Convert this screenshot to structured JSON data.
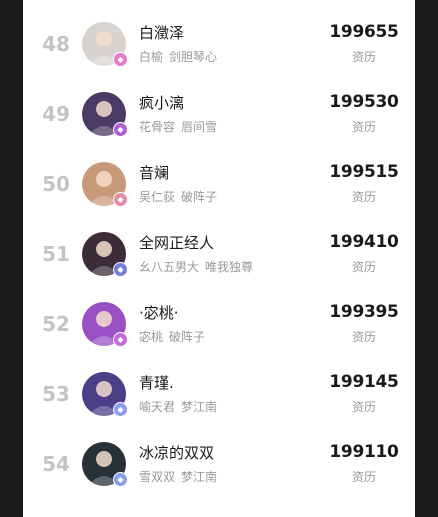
{
  "leaderboard": {
    "rows": [
      {
        "rank": "48",
        "name": "白瀓泽",
        "tags": [
          "白榆",
          "剑胆琴心"
        ],
        "score": "199655",
        "unit": "资历",
        "avatar_icon": "dark-hair-character-avatar-icon",
        "avatar_color": "#d9d3cf",
        "badge_color": "#e879c8"
      },
      {
        "rank": "49",
        "name": "疯小漓",
        "tags": [
          "花骨容",
          "眉间雪"
        ],
        "score": "199530",
        "unit": "资历",
        "avatar_icon": "purple-portrait-avatar-icon",
        "avatar_color": "#4a3a64",
        "badge_color": "#b15cd8"
      },
      {
        "rank": "50",
        "name": "音斓",
        "tags": [
          "吴仁荻",
          "破阵子"
        ],
        "score": "199515",
        "unit": "资历",
        "avatar_icon": "brown-hair-girl-avatar-icon",
        "avatar_color": "#c89a78",
        "badge_color": "#e48ca8"
      },
      {
        "rank": "51",
        "name": "全网正经人",
        "tags": [
          "幺八五男大",
          "唯我独尊"
        ],
        "score": "199410",
        "unit": "资历",
        "avatar_icon": "dark-warrior-avatar-icon",
        "avatar_color": "#3c2b38",
        "badge_color": "#6f7fd8"
      },
      {
        "rank": "52",
        "name": "·宓桃·",
        "tags": [
          "宓桃",
          "破阵子"
        ],
        "score": "199395",
        "unit": "资历",
        "avatar_icon": "sunglasses-face-avatar-icon",
        "avatar_color": "#9a4fc4",
        "badge_color": "#c06ad8"
      },
      {
        "rank": "53",
        "name": "青瑾.",
        "tags": [
          "喻天君",
          "梦江南"
        ],
        "score": "199145",
        "unit": "资历",
        "avatar_icon": "violet-character-avatar-icon",
        "avatar_color": "#4b3f8a",
        "badge_color": "#8a9ef0"
      },
      {
        "rank": "54",
        "name": "冰凉的双双",
        "tags": [
          "雪双双",
          "梦江南"
        ],
        "score": "199110",
        "unit": "资历",
        "avatar_icon": "teal-hair-character-avatar-icon",
        "avatar_color": "#25323a",
        "badge_color": "#8a9ef0"
      }
    ]
  }
}
